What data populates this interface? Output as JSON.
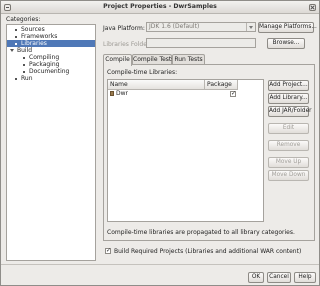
{
  "window": {
    "title": "Project Properties - DwrSamples"
  },
  "categories": {
    "label": "Categories:",
    "items": [
      {
        "label": "Sources",
        "kind": "leaf"
      },
      {
        "label": "Frameworks",
        "kind": "leaf"
      },
      {
        "label": "Libraries",
        "kind": "leaf",
        "selected": true
      },
      {
        "label": "Build",
        "kind": "expander"
      },
      {
        "label": "Compiling",
        "kind": "leaf"
      },
      {
        "label": "Packaging",
        "kind": "leaf"
      },
      {
        "label": "Documenting",
        "kind": "leaf"
      },
      {
        "label": "Run",
        "kind": "leaf"
      }
    ]
  },
  "platform": {
    "label": "Java Platform:",
    "value": "JDK 1.6 (Default)",
    "manage_button": "Manage Platforms..."
  },
  "libraries_folder": {
    "label": "Libraries Folder:",
    "value": "",
    "browse_button": "Browse..."
  },
  "tabs": [
    "Compile",
    "Compile Tests",
    "Run Tests"
  ],
  "compile": {
    "heading": "Compile-time Libraries:",
    "columns": [
      "Name",
      "Package"
    ],
    "rows": [
      {
        "name": "Dwr",
        "package": true
      }
    ],
    "buttons": [
      "Add Project...",
      "Add Library...",
      "Add JAR/Folder",
      "Edit",
      "Remove",
      "Move Up",
      "Move Down"
    ],
    "note": "Compile-time libraries are propagated to all library categories."
  },
  "build_required": {
    "checked": true,
    "label": "Build Required Projects (Libraries and additional WAR content)"
  },
  "footer": {
    "ok": "OK",
    "cancel": "Cancel",
    "help": "Help"
  }
}
